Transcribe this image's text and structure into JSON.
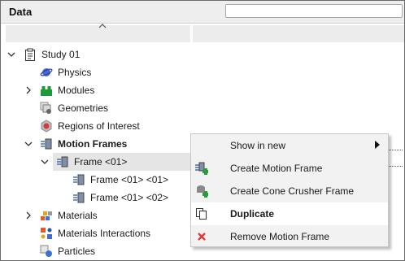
{
  "panel": {
    "title": "Data",
    "search": {
      "value": "",
      "placeholder": ""
    }
  },
  "tree": {
    "study": "Study 01",
    "physics": "Physics",
    "modules": "Modules",
    "geometries": "Geometries",
    "regions": "Regions of Interest",
    "motion_frames": "Motion Frames",
    "frame": "Frame <01>",
    "frame_0101": "Frame <01> <01>",
    "frame_0102": "Frame <01> <02>",
    "materials": "Materials",
    "materials_interactions": "Materials Interactions",
    "particles": "Particles"
  },
  "context_menu": {
    "show_in_new": "Show in new",
    "create_motion_frame": "Create Motion Frame",
    "create_cone_crusher_frame": "Create Cone Crusher Frame",
    "duplicate": "Duplicate",
    "remove_motion_frame": "Remove Motion Frame"
  },
  "colors": {
    "selection": "#e5e5e5",
    "menu_bg": "#f2f2f2",
    "menu_highlight": "#ffffff",
    "remove_icon": "#e03b3b",
    "add_icon": "#2a9d3a"
  },
  "icons": {
    "study": "clipboard-icon",
    "physics": "planet-icon",
    "modules": "modules-icon",
    "geometries": "geometries-icon",
    "regions": "region-icon",
    "motion_frames": "motion-frame-icon",
    "materials": "materials-icon",
    "materials_interactions": "interactions-icon",
    "particles": "particles-icon",
    "duplicate": "duplicate-icon",
    "remove": "remove-icon"
  }
}
